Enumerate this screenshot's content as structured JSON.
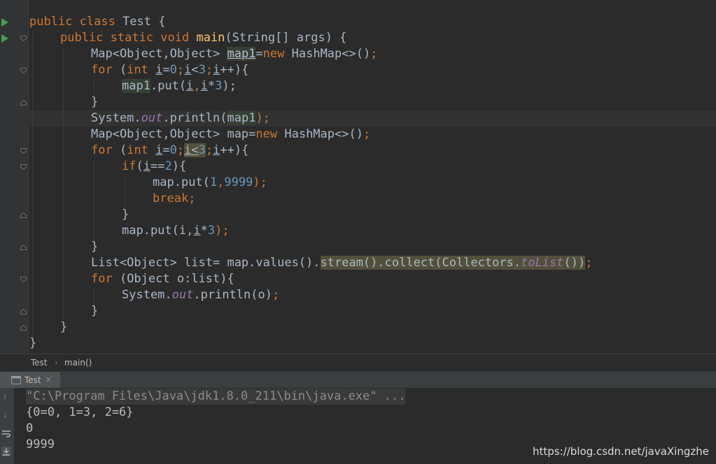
{
  "editor": {
    "lines": {
      "l1": {
        "a": "public class ",
        "b": "Test {"
      },
      "l2": {
        "a": "public static void ",
        "b": "main",
        "c": "(String[] args) {"
      },
      "l3": {
        "a": "Map<Object,Object> ",
        "b": "map1",
        "c": "=",
        "d": "new ",
        "e": "HashMap<>()",
        "f": ";"
      },
      "l4": {
        "a": "for ",
        "b": "(",
        "c": "int ",
        "d": "i",
        "e": "=",
        "f": "0",
        "g": ";",
        "h": "i",
        "i": "<",
        "j": "3",
        "k": ";",
        "l": "i",
        "m": "++){"
      },
      "l5": {
        "a": "map1",
        "b": ".put(",
        "c": "i",
        ",": ",",
        "d": "i",
        "e": "*",
        "f": "3",
        "g": ");"
      },
      "l6": "}",
      "l7": {
        "a": "System.",
        "b": "out",
        "c": ".println(",
        "d": "map1",
        "e": ");"
      },
      "l8": {
        "a": "Map<Object,Object> map=",
        "b": "new ",
        "c": "HashMap<>()",
        "d": ";"
      },
      "l9": {
        "a": "for ",
        "b": "(",
        "c": "int ",
        "d": "i",
        "e": "=",
        "f": "0",
        "g": ";",
        "h": "i<",
        "j": "3",
        "k": ";",
        "l": "i",
        "m": "++){"
      },
      "l10": {
        "a": "if",
        "b": "(",
        "c": "i",
        "d": "==",
        "e": "2",
        "f": "){"
      },
      "l11": {
        "a": "map.put(",
        "b": "1",
        ",": ",",
        "c": "9999",
        "d": ");"
      },
      "l12": {
        "a": "break",
        "b": ";"
      },
      "l13": "}",
      "l14": {
        "a": "map.put(i,",
        "b": "i",
        "c": "*",
        "d": "3",
        "e": ");"
      },
      "l15": "}",
      "l16": {
        "a": "List<Object> list= map.values().",
        "b": "stream().collect(Collectors.",
        "c": "toList",
        "d": "())",
        "e": ";"
      },
      "l17": {
        "a": "for ",
        "b": "(Object o:list){"
      },
      "l18": {
        "a": "System.",
        "b": "out",
        "c": ".println(o)",
        "d": ";"
      },
      "l19": "}",
      "l20": "}",
      "l21": "}"
    }
  },
  "breadcrumb": {
    "class": "Test",
    "sep": "›",
    "method": "main()"
  },
  "run": {
    "tab_label": "Test",
    "command": "\"C:\\Program Files\\Java\\jdk1.8.0_211\\bin\\java.exe\" ...",
    "output": [
      "{0=0, 1=3, 2=6}",
      "0",
      "9999"
    ]
  },
  "watermark": "https://blog.csdn.net/javaXingzhe",
  "colors": {
    "background": "#2b2b2b",
    "keyword": "#cc7832",
    "number": "#6897bb",
    "method": "#ffc66d",
    "static_field": "#9876aa"
  }
}
